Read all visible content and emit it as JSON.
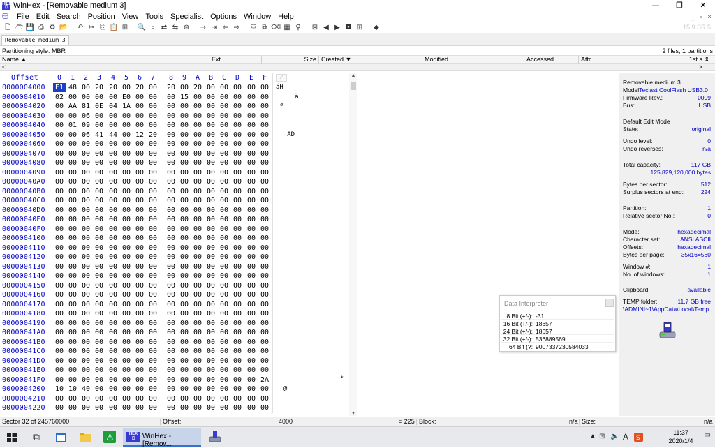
{
  "window": {
    "title": "WinHex - [Removable medium 3]",
    "minimize": "—",
    "restore": "❐",
    "close": "✕"
  },
  "menu": {
    "items": [
      "File",
      "Edit",
      "Search",
      "Position",
      "View",
      "Tools",
      "Specialist",
      "Options",
      "Window",
      "Help"
    ],
    "mdi": [
      "_",
      "▫",
      "×"
    ]
  },
  "toolbar": {
    "zoom_readout": "15.9 SR 5"
  },
  "tab": {
    "label": "Removable medium 3"
  },
  "partition": {
    "style": "Partitioning style: MBR",
    "summary": "2 files, 1 partitions"
  },
  "dir_columns": [
    "Name ▲",
    "Ext.",
    "Size",
    "Created ▼",
    "Modified",
    "Accessed",
    "Attr.",
    "1st s ⇕"
  ],
  "dir_scroll": {
    "left": "<",
    "right": ">"
  },
  "hex_header": {
    "offset": "Offset",
    "cols": [
      "0",
      "1",
      "2",
      "3",
      "4",
      "5",
      "6",
      "7",
      "8",
      "9",
      "A",
      "B",
      "C",
      "D",
      "E",
      "F"
    ]
  },
  "hex_rows": [
    {
      "off": "0000004000",
      "b": [
        "E1",
        "48",
        "00",
        "20",
        "20",
        "00",
        "20",
        "00",
        "20",
        "00",
        "20",
        "00",
        "00",
        "00",
        "00",
        "00"
      ],
      "t": "áH"
    },
    {
      "off": "0000004010",
      "b": [
        "02",
        "00",
        "00",
        "00",
        "00",
        "E0",
        "00",
        "00",
        "00",
        "15",
        "00",
        "00",
        "00",
        "00",
        "00",
        "00"
      ],
      "t": "     à"
    },
    {
      "off": "0000004020",
      "b": [
        "00",
        "AA",
        "81",
        "0E",
        "04",
        "1A",
        "00",
        "00",
        "00",
        "00",
        "00",
        "00",
        "00",
        "00",
        "00",
        "00"
      ],
      "t": " ª"
    },
    {
      "off": "0000004030",
      "b": [
        "00",
        "00",
        "06",
        "00",
        "00",
        "00",
        "00",
        "00",
        "00",
        "00",
        "00",
        "00",
        "00",
        "00",
        "00",
        "00"
      ],
      "t": ""
    },
    {
      "off": "0000004040",
      "b": [
        "00",
        "01",
        "09",
        "00",
        "00",
        "00",
        "00",
        "00",
        "00",
        "00",
        "00",
        "00",
        "00",
        "00",
        "00",
        "00"
      ],
      "t": ""
    },
    {
      "off": "0000004050",
      "b": [
        "00",
        "00",
        "06",
        "41",
        "44",
        "00",
        "12",
        "20",
        "00",
        "00",
        "00",
        "00",
        "00",
        "00",
        "00",
        "00"
      ],
      "t": "   AD"
    },
    {
      "off": "0000004060",
      "b": [
        "00",
        "00",
        "00",
        "00",
        "00",
        "00",
        "00",
        "00",
        "00",
        "00",
        "00",
        "00",
        "00",
        "00",
        "00",
        "00"
      ],
      "t": ""
    },
    {
      "off": "0000004070",
      "b": [
        "00",
        "00",
        "00",
        "00",
        "00",
        "00",
        "00",
        "00",
        "00",
        "00",
        "00",
        "00",
        "00",
        "00",
        "00",
        "00"
      ],
      "t": ""
    },
    {
      "off": "0000004080",
      "b": [
        "00",
        "00",
        "00",
        "00",
        "00",
        "00",
        "00",
        "00",
        "00",
        "00",
        "00",
        "00",
        "00",
        "00",
        "00",
        "00"
      ],
      "t": ""
    },
    {
      "off": "0000004090",
      "b": [
        "00",
        "00",
        "00",
        "00",
        "00",
        "00",
        "00",
        "00",
        "00",
        "00",
        "00",
        "00",
        "00",
        "00",
        "00",
        "00"
      ],
      "t": ""
    },
    {
      "off": "00000040A0",
      "b": [
        "00",
        "00",
        "00",
        "00",
        "00",
        "00",
        "00",
        "00",
        "00",
        "00",
        "00",
        "00",
        "00",
        "00",
        "00",
        "00"
      ],
      "t": ""
    },
    {
      "off": "00000040B0",
      "b": [
        "00",
        "00",
        "00",
        "00",
        "00",
        "00",
        "00",
        "00",
        "00",
        "00",
        "00",
        "00",
        "00",
        "00",
        "00",
        "00"
      ],
      "t": ""
    },
    {
      "off": "00000040C0",
      "b": [
        "00",
        "00",
        "00",
        "00",
        "00",
        "00",
        "00",
        "00",
        "00",
        "00",
        "00",
        "00",
        "00",
        "00",
        "00",
        "00"
      ],
      "t": ""
    },
    {
      "off": "00000040D0",
      "b": [
        "00",
        "00",
        "00",
        "00",
        "00",
        "00",
        "00",
        "00",
        "00",
        "00",
        "00",
        "00",
        "00",
        "00",
        "00",
        "00"
      ],
      "t": ""
    },
    {
      "off": "00000040E0",
      "b": [
        "00",
        "00",
        "00",
        "00",
        "00",
        "00",
        "00",
        "00",
        "00",
        "00",
        "00",
        "00",
        "00",
        "00",
        "00",
        "00"
      ],
      "t": ""
    },
    {
      "off": "00000040F0",
      "b": [
        "00",
        "00",
        "00",
        "00",
        "00",
        "00",
        "00",
        "00",
        "00",
        "00",
        "00",
        "00",
        "00",
        "00",
        "00",
        "00"
      ],
      "t": ""
    },
    {
      "off": "0000004100",
      "b": [
        "00",
        "00",
        "00",
        "00",
        "00",
        "00",
        "00",
        "00",
        "00",
        "00",
        "00",
        "00",
        "00",
        "00",
        "00",
        "00"
      ],
      "t": ""
    },
    {
      "off": "0000004110",
      "b": [
        "00",
        "00",
        "00",
        "00",
        "00",
        "00",
        "00",
        "00",
        "00",
        "00",
        "00",
        "00",
        "00",
        "00",
        "00",
        "00"
      ],
      "t": ""
    },
    {
      "off": "0000004120",
      "b": [
        "00",
        "00",
        "00",
        "00",
        "00",
        "00",
        "00",
        "00",
        "00",
        "00",
        "00",
        "00",
        "00",
        "00",
        "00",
        "00"
      ],
      "t": ""
    },
    {
      "off": "0000004130",
      "b": [
        "00",
        "00",
        "00",
        "00",
        "00",
        "00",
        "00",
        "00",
        "00",
        "00",
        "00",
        "00",
        "00",
        "00",
        "00",
        "00"
      ],
      "t": ""
    },
    {
      "off": "0000004140",
      "b": [
        "00",
        "00",
        "00",
        "00",
        "00",
        "00",
        "00",
        "00",
        "00",
        "00",
        "00",
        "00",
        "00",
        "00",
        "00",
        "00"
      ],
      "t": ""
    },
    {
      "off": "0000004150",
      "b": [
        "00",
        "00",
        "00",
        "00",
        "00",
        "00",
        "00",
        "00",
        "00",
        "00",
        "00",
        "00",
        "00",
        "00",
        "00",
        "00"
      ],
      "t": ""
    },
    {
      "off": "0000004160",
      "b": [
        "00",
        "00",
        "00",
        "00",
        "00",
        "00",
        "00",
        "00",
        "00",
        "00",
        "00",
        "00",
        "00",
        "00",
        "00",
        "00"
      ],
      "t": ""
    },
    {
      "off": "0000004170",
      "b": [
        "00",
        "00",
        "00",
        "00",
        "00",
        "00",
        "00",
        "00",
        "00",
        "00",
        "00",
        "00",
        "00",
        "00",
        "00",
        "00"
      ],
      "t": ""
    },
    {
      "off": "0000004180",
      "b": [
        "00",
        "00",
        "00",
        "00",
        "00",
        "00",
        "00",
        "00",
        "00",
        "00",
        "00",
        "00",
        "00",
        "00",
        "00",
        "00"
      ],
      "t": ""
    },
    {
      "off": "0000004190",
      "b": [
        "00",
        "00",
        "00",
        "00",
        "00",
        "00",
        "00",
        "00",
        "00",
        "00",
        "00",
        "00",
        "00",
        "00",
        "00",
        "00"
      ],
      "t": ""
    },
    {
      "off": "00000041A0",
      "b": [
        "00",
        "00",
        "00",
        "00",
        "00",
        "00",
        "00",
        "00",
        "00",
        "00",
        "00",
        "00",
        "00",
        "00",
        "00",
        "00"
      ],
      "t": ""
    },
    {
      "off": "00000041B0",
      "b": [
        "00",
        "00",
        "00",
        "00",
        "00",
        "00",
        "00",
        "00",
        "00",
        "00",
        "00",
        "00",
        "00",
        "00",
        "00",
        "00"
      ],
      "t": ""
    },
    {
      "off": "00000041C0",
      "b": [
        "00",
        "00",
        "00",
        "00",
        "00",
        "00",
        "00",
        "00",
        "00",
        "00",
        "00",
        "00",
        "00",
        "00",
        "00",
        "00"
      ],
      "t": ""
    },
    {
      "off": "00000041D0",
      "b": [
        "00",
        "00",
        "00",
        "00",
        "00",
        "00",
        "00",
        "00",
        "00",
        "00",
        "00",
        "00",
        "00",
        "00",
        "00",
        "00"
      ],
      "t": ""
    },
    {
      "off": "00000041E0",
      "b": [
        "00",
        "00",
        "00",
        "00",
        "00",
        "00",
        "00",
        "00",
        "00",
        "00",
        "00",
        "00",
        "00",
        "00",
        "00",
        "00"
      ],
      "t": ""
    },
    {
      "off": "00000041F0",
      "b": [
        "00",
        "00",
        "00",
        "00",
        "00",
        "00",
        "00",
        "00",
        "00",
        "00",
        "00",
        "00",
        "00",
        "00",
        "00",
        "2A"
      ],
      "t": ""
    },
    {
      "off": "0000004200",
      "b": [
        "10",
        "10",
        "40",
        "00",
        "00",
        "00",
        "00",
        "00",
        "00",
        "00",
        "00",
        "00",
        "00",
        "00",
        "00",
        "00"
      ],
      "t": "  @"
    },
    {
      "off": "0000004210",
      "b": [
        "00",
        "00",
        "00",
        "00",
        "00",
        "00",
        "00",
        "00",
        "00",
        "00",
        "00",
        "00",
        "00",
        "00",
        "00",
        "00"
      ],
      "t": ""
    },
    {
      "off": "0000004220",
      "b": [
        "00",
        "00",
        "00",
        "00",
        "00",
        "00",
        "00",
        "00",
        "00",
        "00",
        "00",
        "00",
        "00",
        "00",
        "00",
        "00"
      ],
      "t": ""
    }
  ],
  "hex_misc": {
    "star": "*",
    "scroll_up": "▲",
    "scroll_down": "▼"
  },
  "info": {
    "medium": "Removable medium 3",
    "model_label": "Model",
    "model_value": "Teclast CoolFlash USB3.0",
    "firmware_label": "Firmware Rev.:",
    "firmware_value": "0009",
    "bus_label": "Bus:",
    "bus_value": "USB",
    "edit_mode": "Default Edit Mode",
    "state_label": "State:",
    "state_value": "original",
    "undo_level_label": "Undo level:",
    "undo_level_value": "0",
    "undo_rev_label": "Undo reverses:",
    "undo_rev_value": "n/a",
    "capacity_label": "Total capacity:",
    "capacity_value": "117 GB",
    "capacity_bytes": "125,829,120,000 bytes",
    "bps_label": "Bytes per sector:",
    "bps_value": "512",
    "surplus_label": "Surplus sectors at end:",
    "surplus_value": "224",
    "partition_label": "Partition:",
    "partition_value": "1",
    "relsec_label": "Relative sector No.:",
    "relsec_value": "0",
    "mode_label": "Mode:",
    "mode_value": "hexadecimal",
    "charset_label": "Character set:",
    "charset_value": "ANSI ASCII",
    "offsets_label": "Offsets:",
    "offsets_value": "hexadecimal",
    "bpp_label": "Bytes per page:",
    "bpp_value": "35x16=560",
    "window_label": "Window #:",
    "window_value": "1",
    "nwin_label": "No. of windows:",
    "nwin_value": "1",
    "clipboard_label": "Clipboard:",
    "clipboard_value": "available",
    "temp_label": "TEMP folder:",
    "temp_value": "11.7 GB free",
    "temp_path": "\\ADMINI~1\\AppData\\Local\\Temp"
  },
  "data_interpreter": {
    "title": "Data Interpreter",
    "rows": [
      {
        "k": "8 Bit (+/-):",
        "v": "-31"
      },
      {
        "k": "16 Bit (+/-):",
        "v": "18657"
      },
      {
        "k": "24 Bit (+/-):",
        "v": "18657"
      },
      {
        "k": "32 Bit (+/-):",
        "v": "536889569"
      },
      {
        "k": "64 Bit (?:",
        "v": "9007337230584033"
      }
    ]
  },
  "status": {
    "sector": "Sector 32 of 245760000",
    "offset_label": "Offset:",
    "offset_value": "4000",
    "value": "= 225",
    "block_label": "Block:",
    "block_value": "n/a",
    "size_label": "Size:",
    "size_value": "n/a"
  },
  "taskbar": {
    "app_label": "WinHex - [Remov...",
    "ime": "A",
    "time": "11:37",
    "date": "2020/1/4"
  }
}
